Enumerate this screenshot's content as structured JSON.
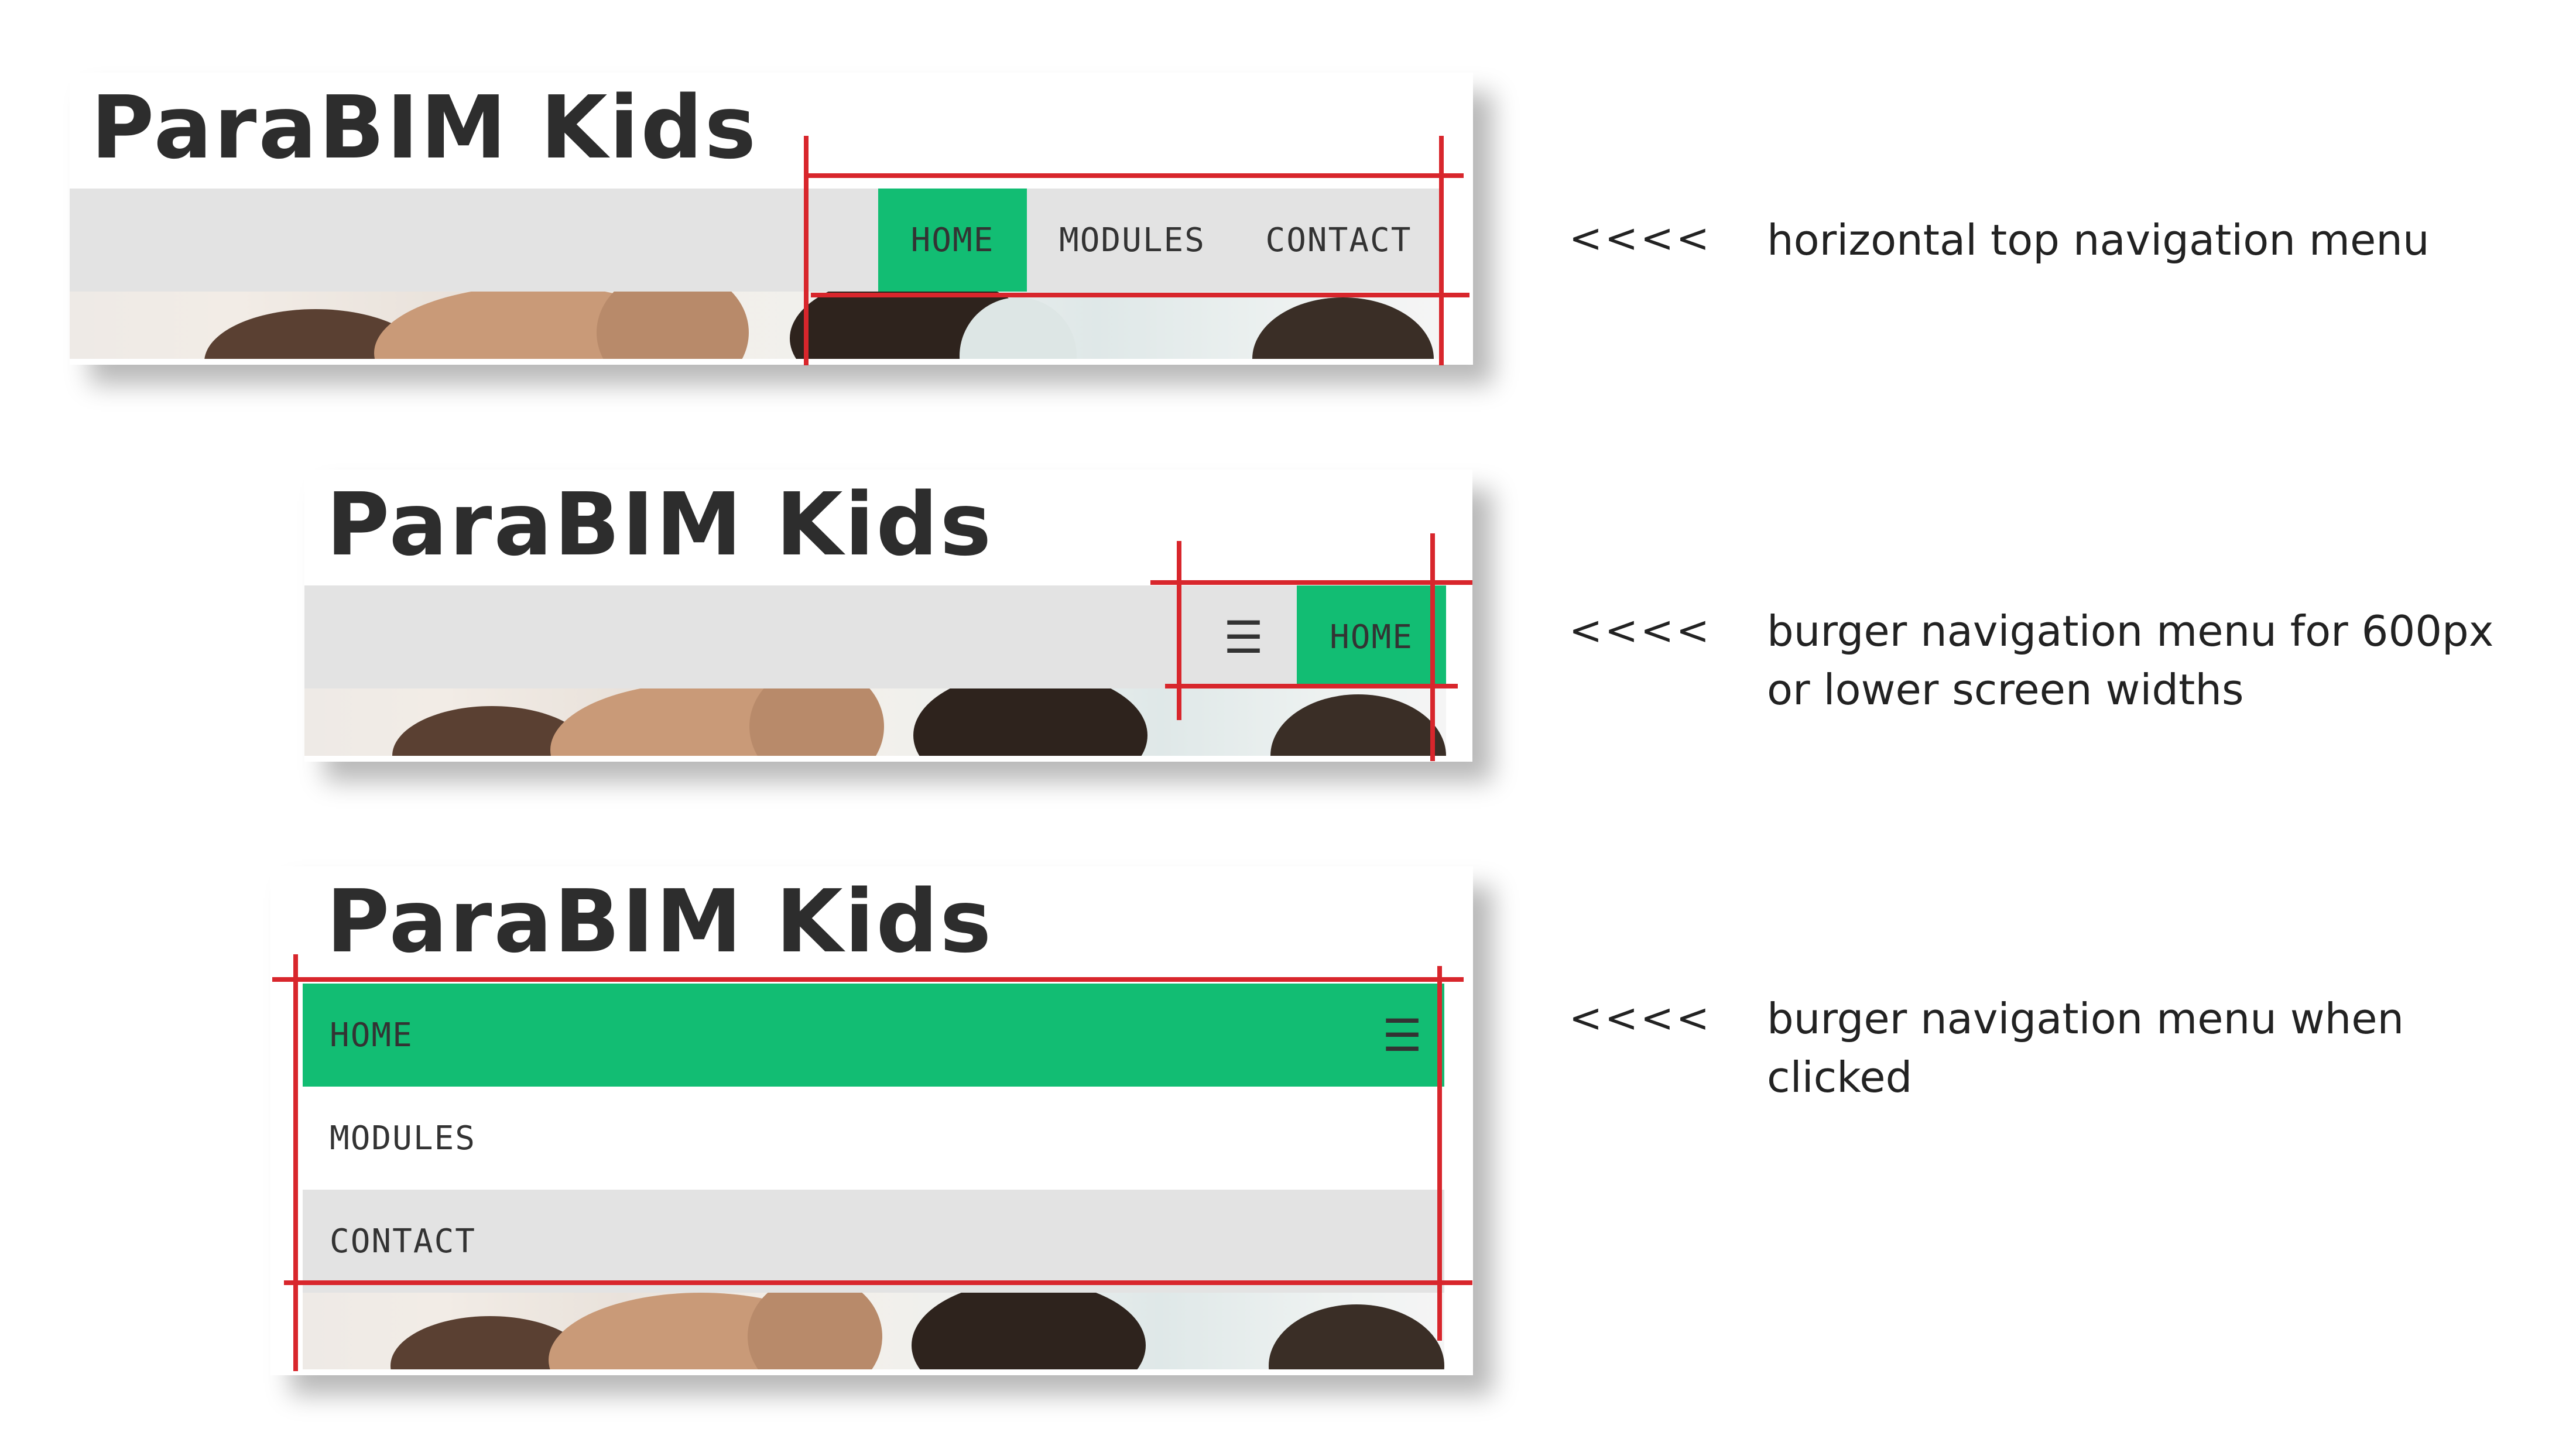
{
  "colors": {
    "accent": "#12bd73",
    "nav_bg": "#e3e3e3",
    "annotation_red": "#d8262c",
    "title_text": "#2d2d2d"
  },
  "site": {
    "title": "ParaBIM Kids"
  },
  "variant_horizontal": {
    "nav": {
      "items": [
        "HOME",
        "MODULES",
        "CONTACT"
      ],
      "active_index": 0
    },
    "annotation": {
      "arrows": "<<<<",
      "text": "horizontal top navigation menu"
    }
  },
  "variant_burger": {
    "burger_icon": "menu-icon",
    "nav": {
      "items": [
        "HOME"
      ],
      "active_index": 0
    },
    "annotation": {
      "arrows": "<<<<",
      "text": "burger navigation menu for 600px or lower screen widths"
    }
  },
  "variant_burger_open": {
    "burger_icon": "menu-icon",
    "nav": {
      "items": [
        "HOME",
        "MODULES",
        "CONTACT"
      ],
      "active_index": 0
    },
    "annotation": {
      "arrows": "<<<<",
      "text": "burger navigation menu when clicked"
    }
  }
}
